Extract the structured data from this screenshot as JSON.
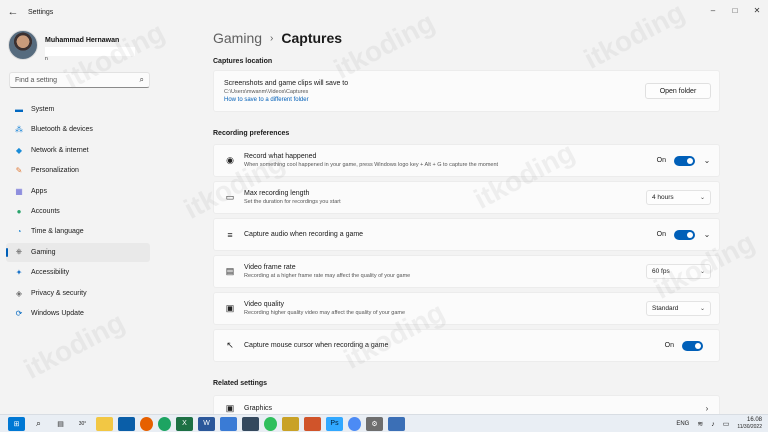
{
  "window": {
    "app_title": "Settings",
    "back_glyph": "←",
    "minimize": "–",
    "maximize": "□",
    "close": "✕"
  },
  "profile": {
    "name": "Muhammad Hernawan",
    "email_prefix": "n"
  },
  "search": {
    "placeholder": "Find a setting",
    "icon": "search-icon"
  },
  "sidebar": {
    "items": [
      {
        "label": "System",
        "icon": "system-icon",
        "color": "#0067c0",
        "active": false
      },
      {
        "label": "Bluetooth & devices",
        "icon": "bluetooth-icon",
        "color": "#0078d4",
        "active": false
      },
      {
        "label": "Network & internet",
        "icon": "wifi-icon",
        "color": "#1a8cd8",
        "active": false
      },
      {
        "label": "Personalization",
        "icon": "brush-icon",
        "color": "#e07b39",
        "active": false
      },
      {
        "label": "Apps",
        "icon": "apps-icon",
        "color": "#6b6bd6",
        "active": false
      },
      {
        "label": "Accounts",
        "icon": "person-icon",
        "color": "#2aa36b",
        "active": false
      },
      {
        "label": "Time & language",
        "icon": "globe-clock-icon",
        "color": "#1f86d1",
        "active": false
      },
      {
        "label": "Gaming",
        "icon": "gamepad-icon",
        "color": "#555555",
        "active": true
      },
      {
        "label": "Accessibility",
        "icon": "accessibility-icon",
        "color": "#1a73c9",
        "active": false
      },
      {
        "label": "Privacy & security",
        "icon": "shield-icon",
        "color": "#6c6c6c",
        "active": false
      },
      {
        "label": "Windows Update",
        "icon": "update-icon",
        "color": "#0067c0",
        "active": false
      }
    ]
  },
  "breadcrumb": {
    "parent": "Gaming",
    "separator": "›",
    "current": "Captures"
  },
  "captures_location": {
    "heading": "Captures location",
    "title": "Screenshots and game clips will save to",
    "path": "C:\\Users\\mwanm\\Videos\\Captures",
    "link": "How to save to a different folder",
    "button": "Open folder"
  },
  "recording_preferences": {
    "heading": "Recording preferences",
    "rows": [
      {
        "title": "Record what happened",
        "sub": "When something cool happened in your game, press Windows logo key + Alt + G to capture the moment",
        "control": "toggle",
        "state": "On",
        "icon": "record-icon"
      },
      {
        "title": "Max recording length",
        "sub": "Set the duration for recordings you start",
        "control": "dropdown",
        "value": "4 hours",
        "icon": "camera-icon"
      },
      {
        "title": "Capture audio when recording a game",
        "sub": "",
        "control": "toggle",
        "state": "On",
        "icon": "audio-icon"
      },
      {
        "title": "Video frame rate",
        "sub": "Recording at a higher frame rate may affect the quality of your game",
        "control": "dropdown",
        "value": "60 fps",
        "icon": "film-icon"
      },
      {
        "title": "Video quality",
        "sub": "Recording higher quality video may affect the quality of your game",
        "control": "dropdown",
        "value": "Standard",
        "icon": "quality-icon"
      },
      {
        "title": "Capture mouse cursor when recording a game",
        "sub": "",
        "control": "toggle-only",
        "state": "On",
        "icon": "cursor-icon"
      }
    ]
  },
  "related_settings": {
    "heading": "Related settings",
    "graphics": "Graphics"
  },
  "watermark": "itkoding",
  "taskbar": {
    "weather": "30°",
    "language": "ENG",
    "time": "16.08",
    "date": "11/30/2022"
  }
}
